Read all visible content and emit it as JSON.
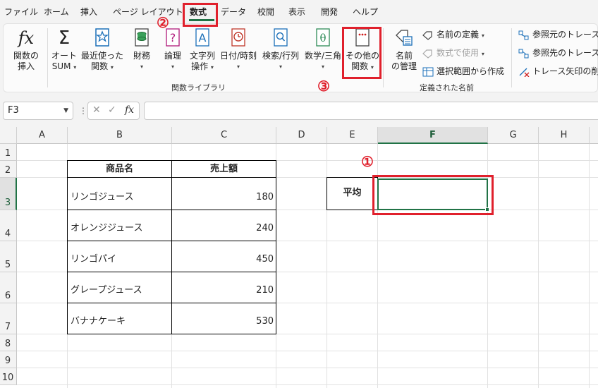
{
  "menu": {
    "tabs": [
      "ファイル",
      "ホーム",
      "挿入",
      "ページ レイアウト",
      "数式",
      "データ",
      "校閲",
      "表示",
      "開発",
      "ヘルプ"
    ],
    "active_tab": "数式"
  },
  "ribbon": {
    "insert_function": "関数の\n挿入",
    "insert_function_l1": "関数の",
    "insert_function_l2": "挿入",
    "autosum_l1": "オート",
    "autosum_l2": "SUM",
    "recent_l1": "最近使った",
    "recent_l2": "関数",
    "financial": "財務",
    "logical": "論理",
    "text_l1": "文字列",
    "text_l2": "操作",
    "datetime": "日付/時刻",
    "lookup": "検索/行列",
    "math": "数学/三角",
    "more_l1": "その他の",
    "more_l2": "関数",
    "name_manager_l1": "名前",
    "name_manager_l2": "の管理",
    "define_name": "名前の定義",
    "use_in_formula": "数式で使用",
    "create_from_selection": "選択範囲から作成",
    "trace_precedents": "参照元のトレース",
    "trace_dependents": "参照先のトレース",
    "remove_arrows": "トレース矢印の削除",
    "group_function_library": "関数ライブラリ",
    "group_defined_names": "定義された名前"
  },
  "formula_bar": {
    "name_box": "F3",
    "fx": "fx",
    "formula": ""
  },
  "columns": [
    "A",
    "B",
    "C",
    "D",
    "E",
    "F",
    "G",
    "H"
  ],
  "rows": [
    "1",
    "2",
    "3",
    "4",
    "5",
    "6",
    "7",
    "8",
    "9",
    "10"
  ],
  "table": {
    "headers": [
      "商品名",
      "売上額"
    ],
    "rows": [
      [
        "リンゴジュース",
        "180"
      ],
      [
        "オレンジジュース",
        "240"
      ],
      [
        "リンゴパイ",
        "450"
      ],
      [
        "グレープジュース",
        "210"
      ],
      [
        "バナナケーキ",
        "530"
      ]
    ]
  },
  "average_label": "平均",
  "callouts": [
    "①",
    "②",
    "③"
  ],
  "colors": {
    "accent": "#217346",
    "callout": "#e0202c"
  }
}
